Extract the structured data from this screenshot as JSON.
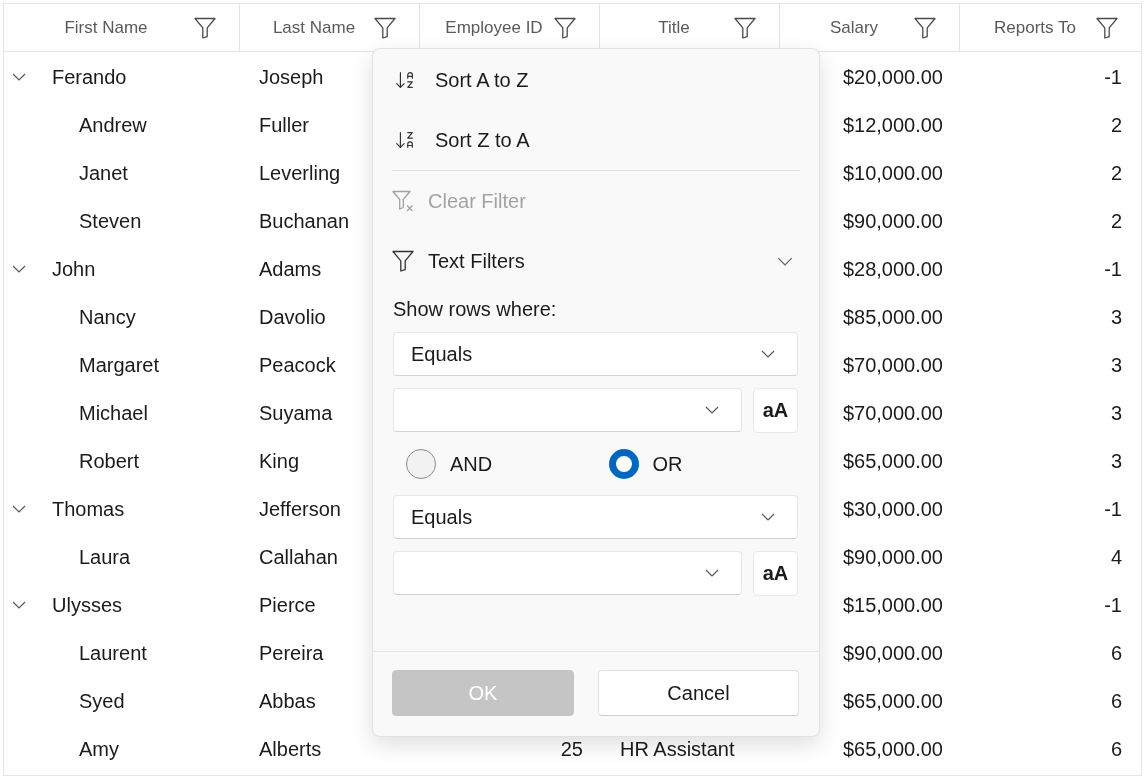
{
  "columns": [
    {
      "label": "First Name"
    },
    {
      "label": "Last Name"
    },
    {
      "label": "Employee ID"
    },
    {
      "label": "Title"
    },
    {
      "label": "Salary"
    },
    {
      "label": "Reports To"
    }
  ],
  "rows": [
    {
      "first_name": "Ferando",
      "last_name": "Joseph",
      "salary": "$20,000.00",
      "reports_to": "-1",
      "expanded": true,
      "children": [
        {
          "first_name": "Andrew",
          "last_name": "Fuller",
          "salary": "$12,000.00",
          "reports_to": "2"
        },
        {
          "first_name": "Janet",
          "last_name": "Leverling",
          "salary": "$10,000.00",
          "reports_to": "2"
        },
        {
          "first_name": "Steven",
          "last_name": "Buchanan",
          "salary": "$90,000.00",
          "reports_to": "2"
        }
      ]
    },
    {
      "first_name": "John",
      "last_name": "Adams",
      "salary": "$28,000.00",
      "reports_to": "-1",
      "expanded": true,
      "children": [
        {
          "first_name": "Nancy",
          "last_name": "Davolio",
          "salary": "$85,000.00",
          "reports_to": "3"
        },
        {
          "first_name": "Margaret",
          "last_name": "Peacock",
          "salary": "$70,000.00",
          "reports_to": "3"
        },
        {
          "first_name": "Michael",
          "last_name": "Suyama",
          "salary": "$70,000.00",
          "reports_to": "3"
        },
        {
          "first_name": "Robert",
          "last_name": "King",
          "salary": "$65,000.00",
          "reports_to": "3"
        }
      ]
    },
    {
      "first_name": "Thomas",
      "last_name": "Jefferson",
      "salary": "$30,000.00",
      "reports_to": "-1",
      "expanded": true,
      "children": [
        {
          "first_name": "Laura",
          "last_name": "Callahan",
          "salary": "$90,000.00",
          "reports_to": "4"
        }
      ]
    },
    {
      "first_name": "Ulysses",
      "last_name": "Pierce",
      "salary": "$15,000.00",
      "reports_to": "-1",
      "expanded": true,
      "children": [
        {
          "first_name": "Laurent",
          "last_name": "Pereira",
          "salary": "$90,000.00",
          "reports_to": "6"
        },
        {
          "first_name": "Syed",
          "last_name": "Abbas",
          "salary": "$65,000.00",
          "reports_to": "6"
        },
        {
          "first_name": "Amy",
          "last_name": "Alberts",
          "employee_id": "25",
          "title": "HR Assistant",
          "salary": "$65,000.00",
          "reports_to": "6"
        }
      ]
    }
  ],
  "filter_popup": {
    "menu_items": [
      {
        "kind": "sort_ascending",
        "label": "Sort A to Z",
        "disabled": false
      },
      {
        "kind": "sort_descending",
        "label": "Sort Z to A",
        "disabled": false
      },
      {
        "kind": "clear_filter",
        "label": "Clear Filter",
        "disabled": true
      },
      {
        "kind": "text_filters",
        "label": "Text Filters",
        "disabled": false
      }
    ],
    "prompt": "Show rows where:",
    "conditions": [
      {
        "operator": "Equals",
        "case_button": "aA"
      },
      {
        "operator": "Equals",
        "case_button": "aA"
      }
    ],
    "logic_options": [
      {
        "label": "AND",
        "selected": false
      },
      {
        "label": "OR",
        "selected": true
      }
    ],
    "buttons": [
      {
        "kind": "accent",
        "label": "OK",
        "disabled": true
      },
      {
        "kind": "standard",
        "label": "Cancel",
        "disabled": false
      }
    ]
  }
}
